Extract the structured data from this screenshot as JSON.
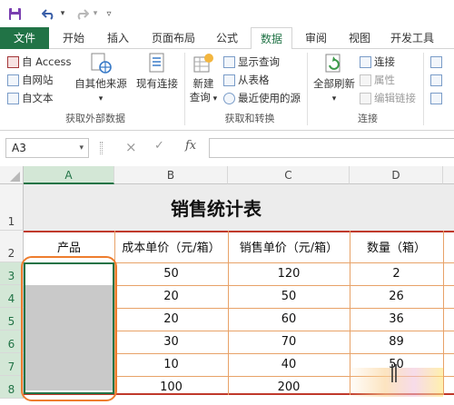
{
  "qat": {
    "save_icon": "save-icon",
    "undo_icon": "undo-icon",
    "redo_icon": "redo-icon",
    "customize_icon": "customize-icon"
  },
  "tabs": [
    {
      "label": "文件"
    },
    {
      "label": "开始"
    },
    {
      "label": "插入"
    },
    {
      "label": "页面布局"
    },
    {
      "label": "公式"
    },
    {
      "label": "数据"
    },
    {
      "label": "审阅"
    },
    {
      "label": "视图"
    },
    {
      "label": "开发工具"
    }
  ],
  "ribbon": {
    "get_external": {
      "access": "自 Access",
      "web": "自网站",
      "text": "自文本",
      "other_sources": "自其他来源",
      "existing": "现有连接",
      "group_label": "获取外部数据"
    },
    "get_transform": {
      "new_query_1": "新建",
      "new_query_2": "查询",
      "show_queries": "显示查询",
      "from_table": "从表格",
      "recent_sources": "最近使用的源",
      "group_label": "获取和转换"
    },
    "connections": {
      "refresh_all": "全部刷新",
      "connections": "连接",
      "properties": "属性",
      "edit_links": "编辑链接",
      "group_label": "连接"
    }
  },
  "formula_bar": {
    "name_box": "A3",
    "fx": "fx",
    "cancel": "×",
    "enter": "✓"
  },
  "columns": [
    "A",
    "B",
    "C",
    "D"
  ],
  "rows": [
    "1",
    "2",
    "3",
    "4",
    "5",
    "6",
    "7",
    "8"
  ],
  "sheet": {
    "title": "销售统计表",
    "headers": [
      "产品",
      "成本单价（元/箱）",
      "销售单价（元/箱）",
      "数量（箱）"
    ],
    "data": [
      [
        "",
        "50",
        "120",
        "2"
      ],
      [
        "",
        "20",
        "50",
        "26"
      ],
      [
        "",
        "20",
        "60",
        "36"
      ],
      [
        "",
        "30",
        "70",
        "89"
      ],
      [
        "",
        "10",
        "40",
        "50"
      ],
      [
        "",
        "100",
        "200",
        ""
      ]
    ]
  },
  "colors": {
    "excel_green": "#217346",
    "table_border": "#e8a268",
    "highlight": "#ee7d2e",
    "selection_fill": "#c9c9c9",
    "title_fill": "#ececec"
  }
}
